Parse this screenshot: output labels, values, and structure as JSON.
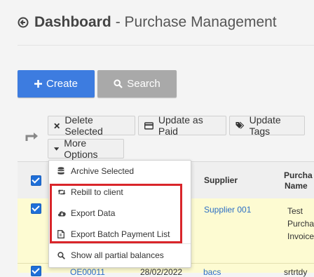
{
  "header": {
    "title": "Dashboard",
    "subtitle": "- Purchase Management"
  },
  "actions": {
    "create_label": "Create",
    "search_label": "Search"
  },
  "toolbar": {
    "delete_label": "Delete Selected",
    "paid_label": "Update as Paid",
    "tags_label": "Update Tags",
    "more_label": "More Options"
  },
  "menu": {
    "items": [
      {
        "label": "Archive Selected",
        "icon": "database-icon"
      },
      {
        "label": "Rebill to client",
        "icon": "retweet-icon"
      },
      {
        "label": "Export Data",
        "icon": "cloud-download-icon"
      },
      {
        "label": "Export Batch Payment List",
        "icon": "file-export-icon"
      },
      {
        "label": "Show all partial balances",
        "icon": "search-icon"
      }
    ]
  },
  "table": {
    "columns": {
      "supplier": "Supplier",
      "purchase_line1": "Purcha",
      "purchase_line2": "Name"
    },
    "rows": [
      {
        "supplier": "Supplier 001",
        "purchase": [
          "Test",
          "Purcha",
          "Invoice"
        ]
      },
      {
        "id": "OE00011",
        "date": "28/02/2022",
        "supplier": "bacs",
        "purchase": "srtrtdy"
      }
    ]
  },
  "colors": {
    "accent": "#3d7ce0",
    "highlight": "#d9252a",
    "row_selected": "#fdfbd2"
  }
}
